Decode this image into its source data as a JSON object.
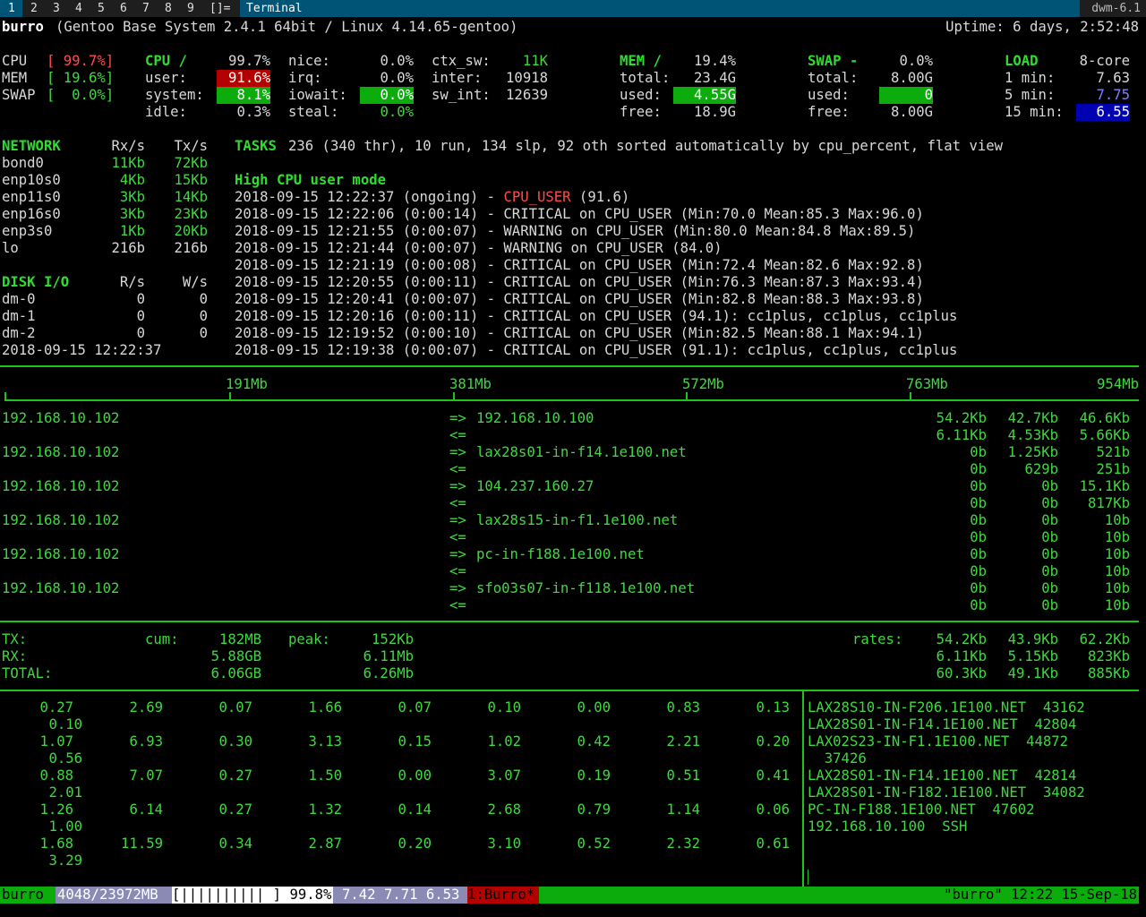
{
  "topbar": {
    "tags": [
      {
        "label": "1",
        "selected": true
      },
      {
        "label": "2",
        "selected": false
      },
      {
        "label": "3",
        "selected": false
      },
      {
        "label": "4",
        "selected": false
      },
      {
        "label": "5",
        "selected": false
      },
      {
        "label": "6",
        "selected": false
      },
      {
        "label": "7",
        "selected": false
      },
      {
        "label": "8",
        "selected": false
      },
      {
        "label": "9",
        "selected": false
      }
    ],
    "layout_symbol": "[]=",
    "window_title": "Terminal",
    "status": "dwm-6.1"
  },
  "glances": {
    "hostname": "burro",
    "system": "(Gentoo Base System 2.4.1 64bit / Linux 4.14.65-gentoo)",
    "uptime": "Uptime: 6 days, 2:52:48",
    "quicklook": {
      "cpu_label": "CPU",
      "cpu_value": "[ 99.7%]",
      "mem_label": "MEM",
      "mem_value": "[ 19.6%]",
      "swap_label": "SWAP",
      "swap_value": "[  0.0%]"
    },
    "cpu": {
      "header": "CPU /",
      "total": "99.7%",
      "user_label": "user:",
      "user": "91.6%",
      "system_label": "system:",
      "system": "8.1%",
      "idle_label": "idle:",
      "idle": "0.3%",
      "nice_label": "nice:",
      "nice": "0.0%",
      "irq_label": "irq:",
      "irq": "0.0%",
      "iowait_label": "iowait:",
      "iowait": "0.0%",
      "steal_label": "steal:",
      "steal": "0.0%",
      "ctx_sw_label": "ctx_sw:",
      "ctx_sw": "11K",
      "inter_label": "inter:",
      "inter": "10918",
      "sw_int_label": "sw_int:",
      "sw_int": "12639"
    },
    "mem": {
      "header": "MEM /",
      "percent": "19.4%",
      "total_label": "total:",
      "total": "23.4G",
      "used_label": "used:",
      "used": "4.55G",
      "free_label": "free:",
      "free": "18.9G"
    },
    "swap": {
      "header": "SWAP -",
      "percent": "0.0%",
      "total_label": "total:",
      "total": "8.00G",
      "used_label": "used:",
      "used": "0",
      "free_label": "free:",
      "free": "8.00G"
    },
    "load": {
      "header": "LOAD",
      "cores": "8-core",
      "min1_label": "1 min:",
      "min1": "7.63",
      "min5_label": "5 min:",
      "min5": "7.75",
      "min15_label": "15 min:",
      "min15": "6.55"
    },
    "network": {
      "header": "NETWORK",
      "rx_header": "Rx/s",
      "tx_header": "Tx/s",
      "rows": [
        {
          "iface": "bond0",
          "rx": "11Kb",
          "tx": "72Kb"
        },
        {
          "iface": "enp10s0",
          "rx": "4Kb",
          "tx": "15Kb"
        },
        {
          "iface": "enp11s0",
          "rx": "3Kb",
          "tx": "14Kb"
        },
        {
          "iface": "enp16s0",
          "rx": "3Kb",
          "tx": "23Kb"
        },
        {
          "iface": "enp3s0",
          "rx": "1Kb",
          "tx": "20Kb"
        },
        {
          "iface": "lo",
          "rx": "216b",
          "tx": "216b"
        }
      ]
    },
    "disk": {
      "header": "DISK I/O",
      "r_header": "R/s",
      "w_header": "W/s",
      "rows": [
        {
          "name": "dm-0",
          "r": "0",
          "w": "0"
        },
        {
          "name": "dm-1",
          "r": "0",
          "w": "0"
        },
        {
          "name": "dm-2",
          "r": "0",
          "w": "0"
        }
      ]
    },
    "datetime": "2018-09-15 12:22:37",
    "tasks": {
      "label": "TASKS",
      "summary": "236 (340 thr), 10 run, 134 slp, 92 oth sorted automatically by cpu_percent, flat view"
    },
    "alerts": {
      "header": "High CPU user mode",
      "ongoing": {
        "prefix": "2018-09-15 12:22:37 (ongoing) - ",
        "key": "CPU_USER",
        "suffix": " (91.6)"
      },
      "rows": [
        "2018-09-15 12:22:06 (0:00:14) - CRITICAL on CPU_USER (Min:70.0 Mean:85.3 Max:96.0)",
        "2018-09-15 12:21:55 (0:00:07) - WARNING on CPU_USER (Min:80.0 Mean:84.8 Max:89.5)",
        "2018-09-15 12:21:44 (0:00:07) - WARNING on CPU_USER (84.0)",
        "2018-09-15 12:21:19 (0:00:08) - CRITICAL on CPU_USER (Min:72.4 Mean:82.6 Max:92.8)",
        "2018-09-15 12:20:55 (0:00:11) - CRITICAL on CPU_USER (Min:76.3 Mean:87.3 Max:93.4)",
        "2018-09-15 12:20:41 (0:00:07) - CRITICAL on CPU_USER (Min:82.8 Mean:88.3 Max:93.8)",
        "2018-09-15 12:20:16 (0:00:11) - CRITICAL on CPU_USER (94.1): cc1plus, cc1plus, cc1plus",
        "2018-09-15 12:19:52 (0:00:10) - CRITICAL on CPU_USER (Min:82.5 Mean:88.1 Max:94.1)",
        "2018-09-15 12:19:38 (0:00:07) - CRITICAL on CPU_USER (91.1): cc1plus, cc1plus, cc1plus"
      ]
    }
  },
  "iftop": {
    "scale": [
      "191Mb",
      "381Mb",
      "572Mb",
      "763Mb",
      "954Mb"
    ],
    "flows": [
      {
        "src": "192.168.10.102",
        "dst": "192.168.10.100",
        "out": [
          "54.2Kb",
          "42.7Kb",
          "46.6Kb"
        ],
        "in": [
          "6.11Kb",
          "4.53Kb",
          "5.66Kb"
        ]
      },
      {
        "src": "192.168.10.102",
        "dst": "lax28s01-in-f14.1e100.net",
        "out": [
          "0b",
          "1.25Kb",
          "521b"
        ],
        "in": [
          "0b",
          "629b",
          "251b"
        ]
      },
      {
        "src": "192.168.10.102",
        "dst": "104.237.160.27",
        "out": [
          "0b",
          "0b",
          "15.1Kb"
        ],
        "in": [
          "0b",
          "0b",
          "817Kb"
        ]
      },
      {
        "src": "192.168.10.102",
        "dst": "lax28s15-in-f1.1e100.net",
        "out": [
          "0b",
          "0b",
          "10b"
        ],
        "in": [
          "0b",
          "0b",
          "10b"
        ]
      },
      {
        "src": "192.168.10.102",
        "dst": "pc-in-f188.1e100.net",
        "out": [
          "0b",
          "0b",
          "10b"
        ],
        "in": [
          "0b",
          "0b",
          "10b"
        ]
      },
      {
        "src": "192.168.10.102",
        "dst": "sfo03s07-in-f118.1e100.net",
        "out": [
          "0b",
          "0b",
          "10b"
        ],
        "in": [
          "0b",
          "0b",
          "10b"
        ]
      }
    ],
    "out_arrow": "=>",
    "in_arrow": "<=",
    "totals": {
      "cum_label": "cum:",
      "peak_label": "peak:",
      "rates_label": "rates:",
      "rows": [
        {
          "label": "TX:",
          "cum": "182MB",
          "peak": "152Kb",
          "rates": [
            "54.2Kb",
            "43.9Kb",
            "62.2Kb"
          ]
        },
        {
          "label": "RX:",
          "cum": "5.88GB",
          "peak": "6.11Mb",
          "rates": [
            "6.11Kb",
            "5.15Kb",
            "823Kb"
          ]
        },
        {
          "label": "TOTAL:",
          "cum": "6.06GB",
          "peak": "6.26Mb",
          "rates": [
            "60.3Kb",
            "49.1Kb",
            "885Kb"
          ]
        }
      ]
    }
  },
  "stats_rows": [
    {
      "values": [
        "0.27",
        "2.69",
        "0.07",
        "1.66",
        "0.07",
        "0.10",
        "0.00",
        "0.83",
        "0.13"
      ],
      "wrap": "0.10"
    },
    {
      "values": [
        "1.07",
        "6.93",
        "0.30",
        "3.13",
        "0.15",
        "1.02",
        "0.42",
        "2.21",
        "0.20"
      ],
      "wrap": "0.56"
    },
    {
      "values": [
        "0.88",
        "7.07",
        "0.27",
        "1.50",
        "0.00",
        "3.07",
        "0.19",
        "0.51",
        "0.41"
      ],
      "wrap": "2.01"
    },
    {
      "values": [
        "1.26",
        "6.14",
        "0.27",
        "1.32",
        "0.14",
        "2.68",
        "0.79",
        "1.14",
        "0.06"
      ],
      "wrap": "1.00"
    },
    {
      "values": [
        "1.68",
        "11.59",
        "0.34",
        "2.87",
        "0.20",
        "3.10",
        "0.52",
        "2.32",
        "0.61"
      ],
      "wrap": "3.29"
    }
  ],
  "connections": [
    "LAX28S10-IN-F206.1E100.NET  43162",
    "LAX28S01-IN-F14.1E100.NET  42804",
    "LAX02S23-IN-F1.1E100.NET  44872",
    "  37426",
    "LAX28S01-IN-F14.1E100.NET  42814",
    "LAX28S01-IN-F182.1E100.NET  34082",
    "PC-IN-F188.1E100.NET  47602",
    "192.168.10.100  SSH"
  ],
  "tmux": {
    "session": "burro",
    "mem": "4048/23972MB",
    "cpu_bar": "[|||||||||| ]",
    "cpu_percent": "99.8%",
    "load": "7.42 7.71 6.53",
    "window": "1:Burro*",
    "right": "\"burro\" 12:22 15-Sep-18"
  },
  "colors": {
    "green": "#2fdc2f",
    "bar_green": "#0bac0b",
    "critical_red": "#b30000",
    "tag_selected": "#005577"
  }
}
